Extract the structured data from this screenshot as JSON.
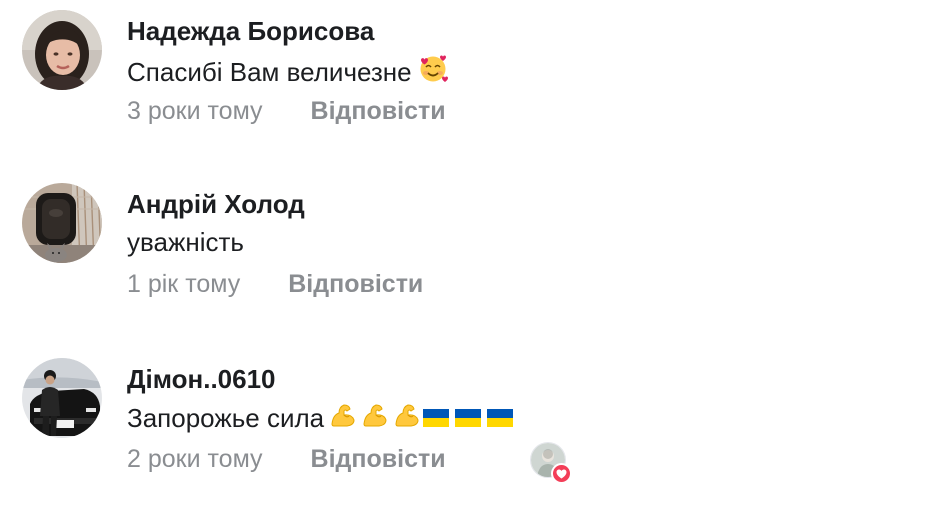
{
  "comments": [
    {
      "author": "Надежда Борисова",
      "text": "Спасибі Вам величезне",
      "emojis": [
        "smiling-face-with-hearts"
      ],
      "time": "3 роки тому",
      "reply_label": "Відповісти",
      "avatar": "woman-portrait"
    },
    {
      "author": "Андрій Холод",
      "text": "уважність",
      "emojis": [],
      "time": "1 рік тому",
      "reply_label": "Відповісти",
      "avatar": "dark-object-with-cat"
    },
    {
      "author": "Дімон..0610",
      "text": "Запорожье сила",
      "emojis": [
        "flexed-biceps",
        "flexed-biceps",
        "flexed-biceps",
        "flag-ukraine",
        "flag-ukraine",
        "flag-ukraine"
      ],
      "time": "2 роки тому",
      "reply_label": "Відповісти",
      "avatar": "man-with-black-car",
      "reaction": "love"
    }
  ],
  "colors": {
    "name": "#1c1e21",
    "meta": "#8a8d91",
    "heart": "#f33e58",
    "flag_blue": "#0057b7",
    "flag_yellow": "#ffd700"
  }
}
